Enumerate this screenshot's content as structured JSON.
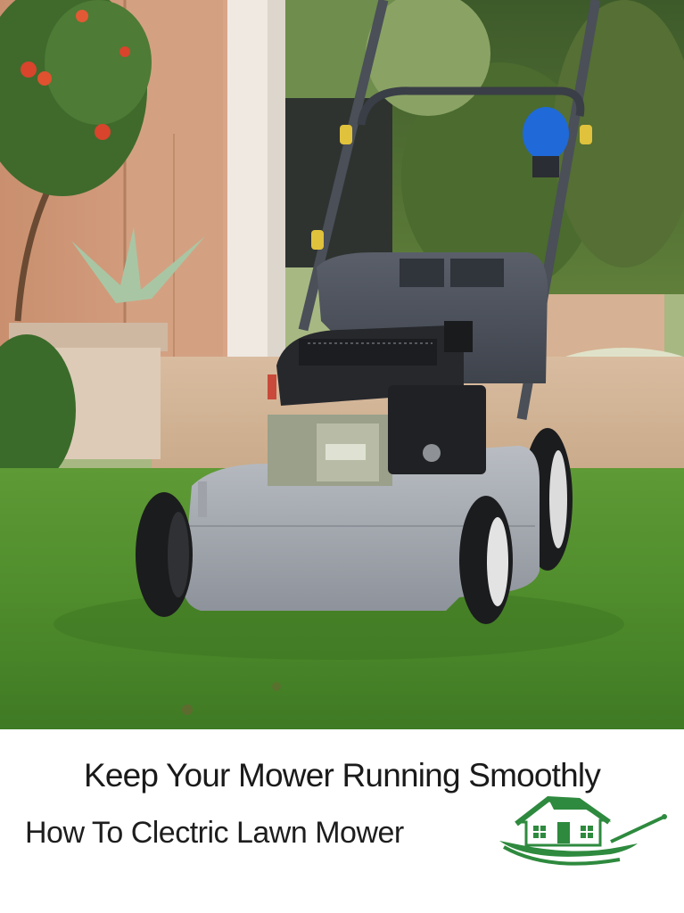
{
  "caption": {
    "headline": "Keep Your Mower Running Smoothly",
    "subheadline": "How To Clectric Lawn Mower"
  },
  "logo": {
    "icon": "house-mower-logo",
    "color": "#2e8a3e"
  },
  "photo": {
    "subject": "lawn-mower-photo"
  }
}
